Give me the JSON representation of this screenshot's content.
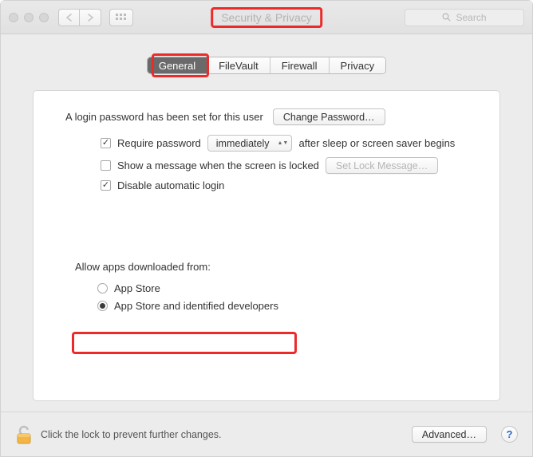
{
  "window_title": "Security & Privacy",
  "toolbar": {
    "search_placeholder": "Search"
  },
  "tabs": {
    "general": "General",
    "filevault": "FileVault",
    "firewall": "Firewall",
    "privacy": "Privacy"
  },
  "general": {
    "login_password_set_text": "A login password has been set for this user",
    "change_password_btn": "Change Password…",
    "require_password_label": "Require password",
    "require_password_delay": "immediately",
    "require_password_after": "after sleep or screen saver begins",
    "show_message_label": "Show a message when the screen is locked",
    "set_lock_message_btn": "Set Lock Message…",
    "disable_auto_login_label": "Disable automatic login",
    "allow_apps_label": "Allow apps downloaded from:",
    "app_store_option": "App Store",
    "app_store_identified_option": "App Store and identified developers"
  },
  "footer": {
    "lock_text": "Click the lock to prevent further changes.",
    "advanced_btn": "Advanced…",
    "help": "?"
  }
}
